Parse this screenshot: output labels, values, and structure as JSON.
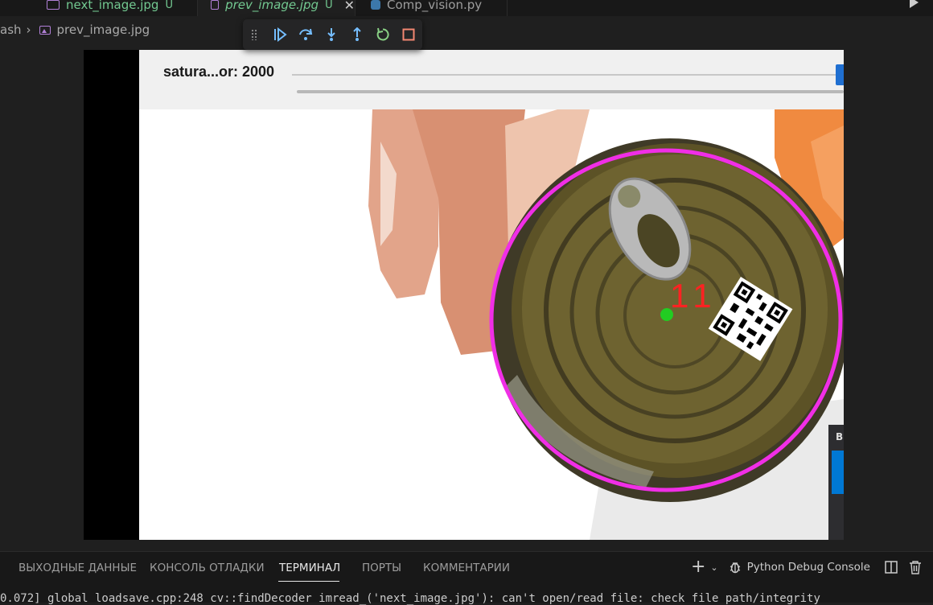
{
  "tabs": [
    {
      "label": "next_image.jpg",
      "badge": "U",
      "state": "inactive"
    },
    {
      "label": "prev_image.jpg",
      "badge": "U",
      "state": "active"
    },
    {
      "label": "Comp_vision.py",
      "state": "inactive"
    }
  ],
  "breadcrumb": {
    "parent": "ash",
    "file": "prev_image.jpg"
  },
  "debug_toolbar": {
    "buttons": [
      "continue",
      "step-over",
      "step-into",
      "step-out",
      "restart",
      "stop"
    ]
  },
  "viewer": {
    "trackbar_label": "satura...or: 2000",
    "overlay_number": "11",
    "side_panel_letter": "B"
  },
  "panel": {
    "tabs": [
      {
        "label": "ВЫХОДНЫЕ ДАННЫЕ"
      },
      {
        "label": "КОНСОЛЬ ОТЛАДКИ"
      },
      {
        "label": "ТЕРМИНАЛ",
        "active": true
      },
      {
        "label": "ПОРТЫ"
      },
      {
        "label": "КОММЕНТАРИИ"
      }
    ],
    "terminal_profile": "Python Debug Console",
    "terminal_line": "0.072] global loadsave.cpp:248 cv::findDecoder imread_('next_image.jpg'): can't open/read file: check file path/integrity"
  },
  "colors": {
    "accent": "#0078d4",
    "modified_green": "#73c991",
    "circle_magenta": "#f02ee6",
    "label_red": "#ff2222",
    "center_green": "#22cc22"
  }
}
